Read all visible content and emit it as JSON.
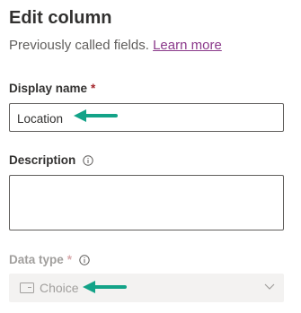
{
  "panel": {
    "title": "Edit column",
    "subtitle": "Previously called fields.",
    "learn_more": "Learn more"
  },
  "fields": {
    "display_name": {
      "label": "Display name",
      "required_mark": "*",
      "value": "Location"
    },
    "description": {
      "label": "Description",
      "value": ""
    },
    "data_type": {
      "label": "Data type",
      "required_mark": "*",
      "value": "Choice",
      "disabled": true
    }
  },
  "icons": {
    "info": "info-icon",
    "choice": "choice-icon",
    "chevron": "chevron-down-icon",
    "annotation_arrow": "arrow-left-icon"
  },
  "colors": {
    "arrow": "#13a388",
    "link": "#8b3a8b",
    "required": "#a4262c"
  }
}
